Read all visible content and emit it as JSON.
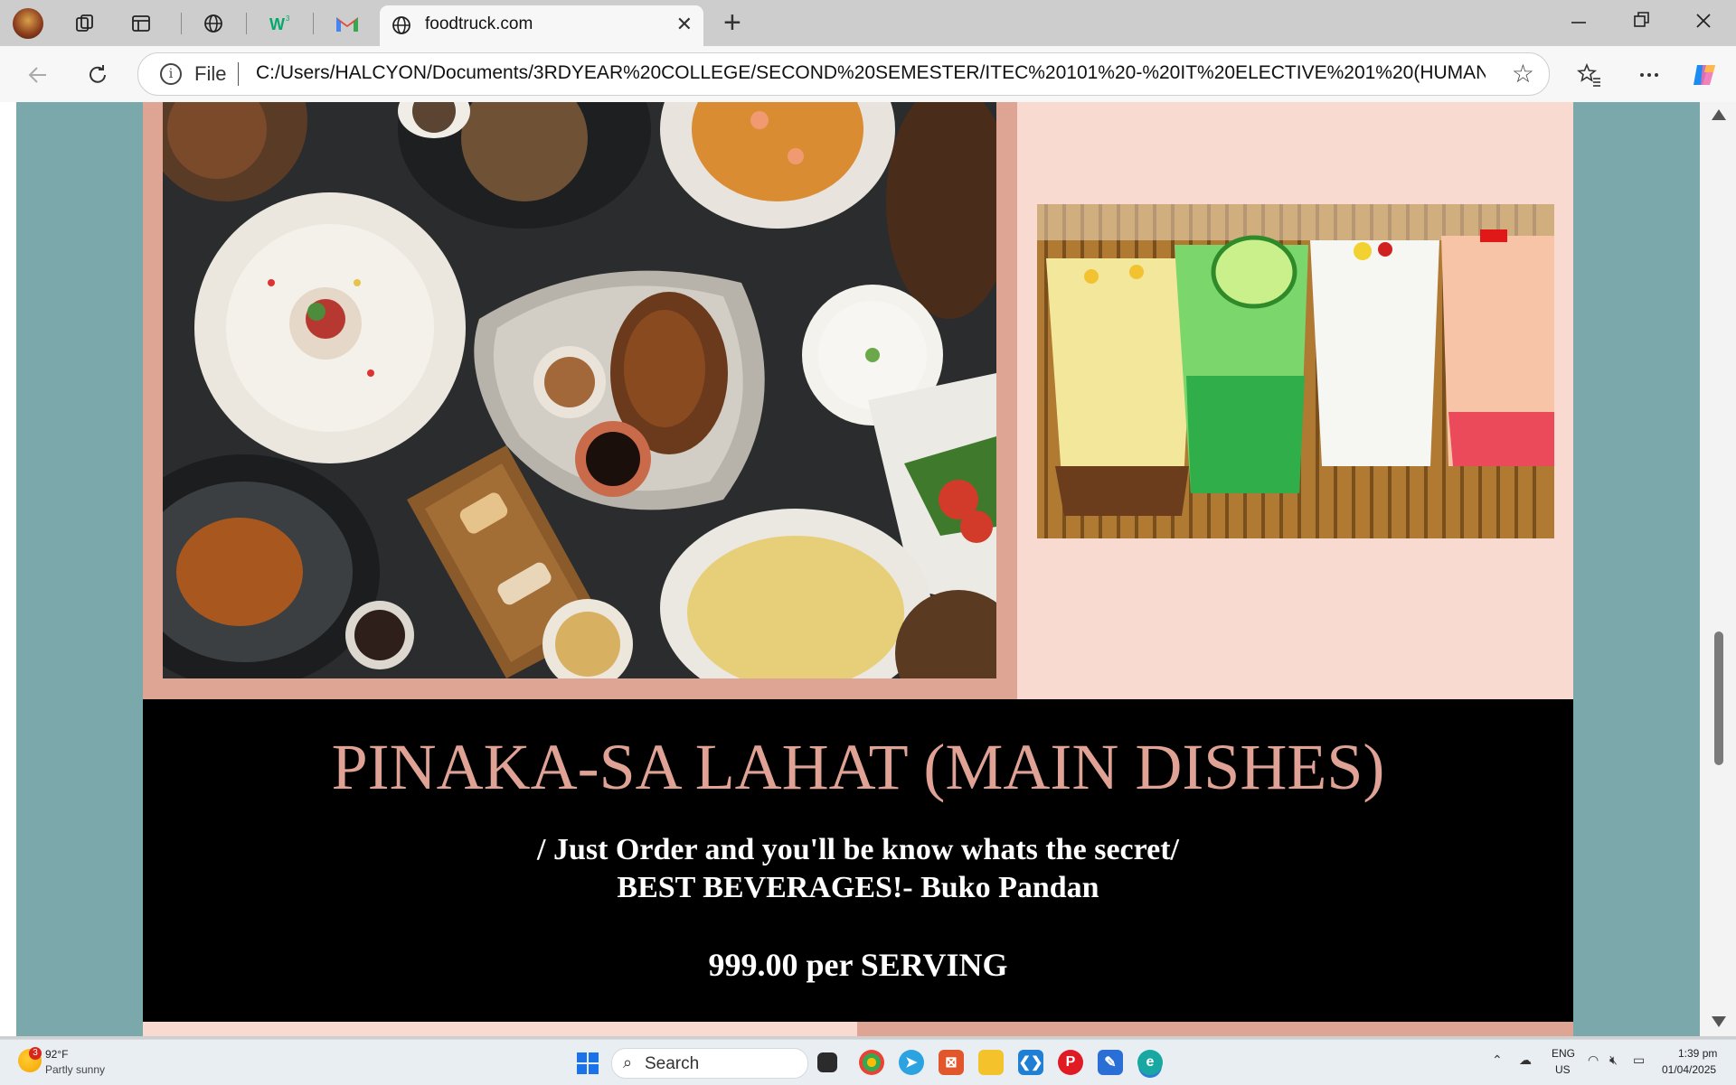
{
  "browser": {
    "tab_title": "foodtruck.com",
    "url_scheme_label": "File",
    "url": "C:/Users/HALCYON/Documents/3RDYEAR%20COLLEGE/SECOND%20SEMESTER/ITEC%20101%20-%20IT%20ELECTIVE%201%20(HUMAN%20CO...",
    "new_tab_symbol": "+",
    "close_symbol": "✕"
  },
  "page": {
    "heading": "PINAKA-SA LAHAT (MAIN DISHES)",
    "line1": "/ Just Order and you'll be know whats the secret/",
    "line2": "BEST BEVERAGES!- Buko Pandan",
    "price": "999.00 per SERVING"
  },
  "taskbar": {
    "weather_temp": "92°F",
    "weather_desc": "Partly sunny",
    "weather_badge": "3",
    "search_label": "Search",
    "lang_line1": "ENG",
    "lang_line2": "US",
    "time": "1:39 pm",
    "date": "01/04/2025"
  },
  "colors": {
    "page_bg": "#7ba8ab",
    "panel_left": "#dea594",
    "panel_right": "#f8dad1",
    "heading_color": "#e0a294"
  }
}
